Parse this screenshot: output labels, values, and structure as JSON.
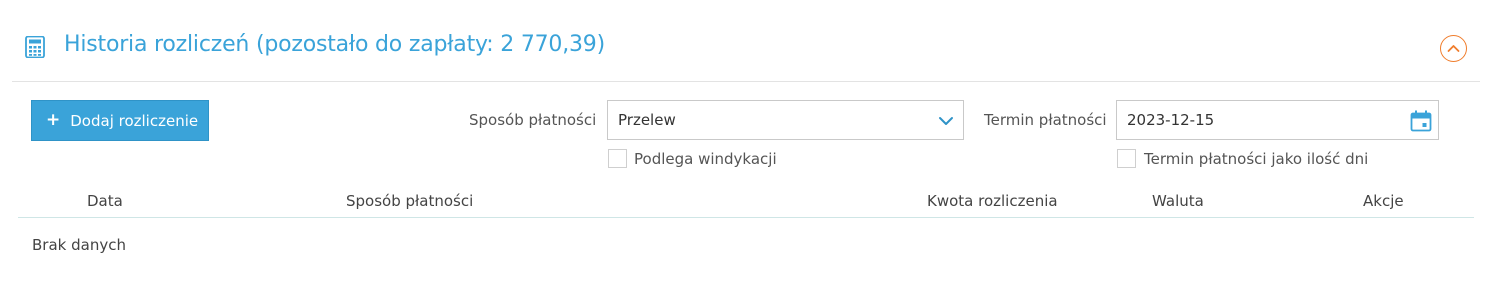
{
  "header": {
    "title": "Historia rozliczeń (pozostało do zapłaty: 2 770,39)",
    "icon": "calculator-icon",
    "collapse_icon": "chevron-up-icon"
  },
  "toolbar": {
    "add_label": "Dodaj rozliczenie",
    "add_icon": "plus-icon"
  },
  "form": {
    "payment_method_label": "Sposób płatności",
    "payment_method_value": "Przelew",
    "payment_term_label": "Termin płatności",
    "payment_term_value": "2023-12-15",
    "collection_label": "Podlega windykacji",
    "collection_checked": false,
    "term_as_days_label": "Termin płatności jako ilość dni",
    "term_as_days_checked": false
  },
  "table": {
    "columns": [
      "Data",
      "Sposób płatności",
      "Kwota rozliczenia",
      "Waluta",
      "Akcje"
    ],
    "rows": [],
    "empty_text": "Brak danych"
  },
  "colors": {
    "accent": "#3aa3d9",
    "collapse": "#f07d2c"
  }
}
